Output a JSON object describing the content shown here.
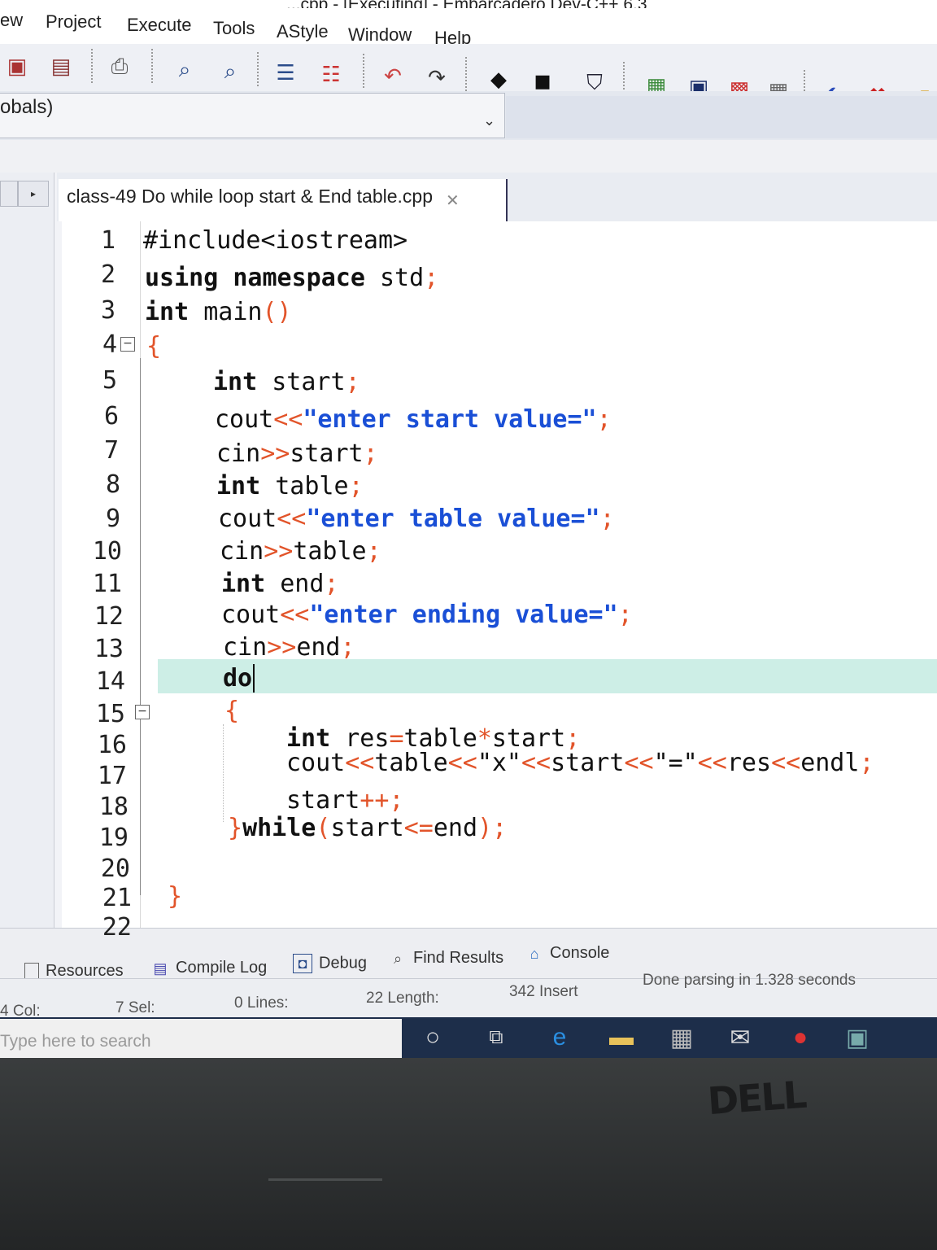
{
  "window": {
    "title": "...cpp - [Executing] - Embarcadero Dev-C++ 6.3"
  },
  "menu": [
    "ew",
    "Project",
    "Execute",
    "Tools",
    "AStyle",
    "Window",
    "Help"
  ],
  "scope": {
    "label": "obals)"
  },
  "file_tab": {
    "name": "class-49 Do while loop start & End table.cpp"
  },
  "editor": {
    "line_numbers": [
      "1",
      "2",
      "3",
      "4",
      "5",
      "6",
      "7",
      "8",
      "9",
      "10",
      "11",
      "12",
      "13",
      "14",
      "15",
      "16",
      "17",
      "18",
      "19",
      "20",
      "21",
      "22"
    ],
    "current_line": 14
  },
  "bottom_tabs": [
    "Resources",
    "Compile Log",
    "Debug",
    "Find Results",
    "Console"
  ],
  "status": {
    "col": "4 Col:",
    "sel": "7 Sel:",
    "lines": "0 Lines:",
    "length": "22 Length:",
    "insert": "342 Insert",
    "message": "Done parsing in 1.328 seconds"
  },
  "taskbar": {
    "search_placeholder": "Type here to search"
  },
  "brand": {
    "logo": "DELL"
  },
  "icons": [
    "save-icon",
    "save-all-icon",
    "print-icon",
    "find-icon",
    "replace-icon",
    "indent-icon",
    "unindent-icon",
    "undo-icon",
    "redo-icon",
    "bookmark-icon",
    "bookmark-next-icon",
    "tag-icon",
    "grid-icon",
    "window-icon",
    "palette-icon",
    "layout-icon",
    "check-icon",
    "stop-icon",
    "chart-icon"
  ],
  "colors": {
    "keyword": "#111111",
    "string": "#1a4fd6",
    "operator": "#e2542a",
    "current_line": "#cdeee6"
  }
}
